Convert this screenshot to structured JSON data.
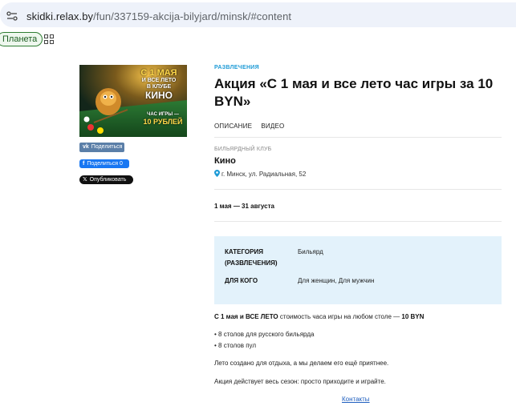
{
  "browser": {
    "url_host": "skidki.relax.by",
    "url_path": "/fun/337159-akcija-bilyjard/minsk/#content",
    "bookmark_label": "Планета"
  },
  "sidebar": {
    "banner": {
      "line1": "С 1 МАЯ",
      "line2": "И ВСЕ ЛЕТО",
      "line3": "В КЛУБЕ",
      "line4": "КИНО",
      "line5": "ЧАС ИГРЫ —",
      "line6": "10 РУБЛЕЙ"
    },
    "share_vk": "Поделиться",
    "share_fb": "Поделиться 0",
    "share_x": "Опубликовать"
  },
  "article": {
    "category": "РАЗВЛЕЧЕНИЯ",
    "title": "Акция «С 1 мая и все лето час игры за 10 BYN»",
    "tabs": [
      "ОПИСАНИЕ",
      "ВИДЕО"
    ],
    "venue_type": "БИЛЬЯРДНЫЙ КЛУБ",
    "venue_name": "Кино",
    "address": "г. Минск, ул. Радиальная, 52",
    "dates": "1 мая — 31 августа",
    "info": {
      "category_label_1": "КАТЕГОРИЯ",
      "category_label_2": "(РАЗВЛЕЧЕНИЯ)",
      "category_value": "Бильярд",
      "audience_label": "ДЛЯ КОГО",
      "audience_value": "Для женщин, Для мужчин"
    },
    "lead_bold": "С 1 мая и ВСЕ ЛЕТО",
    "lead_text": " стоимость часа игры на любом столе — ",
    "lead_price": "10 BYN",
    "bullets": [
      "• 8 столов для русского бильярда",
      "• 8 столов пул"
    ],
    "para1": "Лето создано для отдыха, а мы делаем его ещё приятнее.",
    "para2": "Акция действует весь сезон: просто приходите и играйте.",
    "contacts": "Контакты"
  },
  "colors": {
    "accent": "#1c9ad6",
    "info_bg": "#e3f2fb",
    "link": "#1f5fbf"
  }
}
